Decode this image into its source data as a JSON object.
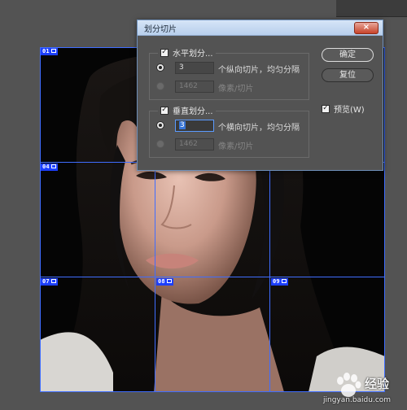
{
  "dialog": {
    "title": "划分切片",
    "close_label": "×",
    "horizontal": {
      "checkbox_label": "水平划分...",
      "count_value": "3",
      "count_label": "个纵向切片，均匀分隔",
      "pixel_value": "1462",
      "pixel_label": "像素/切片"
    },
    "vertical": {
      "checkbox_label": "垂直划分...",
      "count_value": "3",
      "count_label": "个横向切片，均匀分隔",
      "pixel_value": "1462",
      "pixel_label": "像素/切片"
    },
    "ok_label": "确定",
    "reset_label": "复位",
    "preview_label": "预览(W)"
  },
  "slices": [
    "01",
    "04",
    "07",
    "08",
    "09"
  ],
  "watermark": {
    "text": "经验",
    "url": "jingyan.baidu.com"
  },
  "colors": {
    "slice_line": "#3f6dff",
    "slice_tag": "#1c3fff",
    "dialog_bg": "#535353",
    "titlebar": "#c9dbf2"
  }
}
